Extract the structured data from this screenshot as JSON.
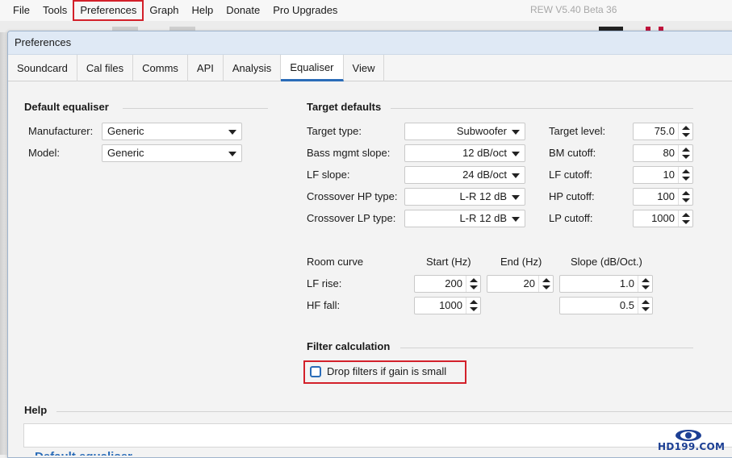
{
  "app": {
    "menu": [
      "File",
      "Tools",
      "Preferences",
      "Graph",
      "Help",
      "Donate",
      "Pro Upgrades"
    ],
    "highlighted_menu": "Preferences",
    "title": "REW V5.40 Beta 36"
  },
  "dialog": {
    "title": "Preferences",
    "tabs": [
      "Soundcard",
      "Cal files",
      "Comms",
      "API",
      "Analysis",
      "Equaliser",
      "View"
    ],
    "active_tab": "Equaliser"
  },
  "default_equaliser": {
    "title": "Default equaliser",
    "manufacturer_label": "Manufacturer:",
    "manufacturer_value": "Generic",
    "model_label": "Model:",
    "model_value": "Generic"
  },
  "target_defaults": {
    "title": "Target defaults",
    "target_type_label": "Target type:",
    "target_type_value": "Subwoofer",
    "bass_mgmt_label": "Bass mgmt slope:",
    "bass_mgmt_value": "12 dB/oct",
    "lf_slope_label": "LF slope:",
    "lf_slope_value": "24 dB/oct",
    "crossover_hp_label": "Crossover HP type:",
    "crossover_hp_value": "L-R 12 dB",
    "crossover_lp_label": "Crossover LP type:",
    "crossover_lp_value": "L-R 12 dB",
    "target_level_label": "Target level:",
    "target_level_value": "75.0",
    "bm_cutoff_label": "BM cutoff:",
    "bm_cutoff_value": "80",
    "lf_cutoff_label": "LF cutoff:",
    "lf_cutoff_value": "10",
    "hp_cutoff_label": "HP cutoff:",
    "hp_cutoff_value": "100",
    "lp_cutoff_label": "LP cutoff:",
    "lp_cutoff_value": "1000"
  },
  "room_curve": {
    "title": "Room curve",
    "start_header": "Start (Hz)",
    "end_header": "End (Hz)",
    "slope_header": "Slope (dB/Oct.)",
    "lf_rise_label": "LF rise:",
    "lf_rise_start": "200",
    "lf_rise_end": "20",
    "lf_rise_slope": "1.0",
    "hf_fall_label": "HF fall:",
    "hf_fall_start": "1000",
    "hf_fall_slope": "0.5"
  },
  "filter_calculation": {
    "title": "Filter calculation",
    "drop_filters_label": "Drop filters if gain is small",
    "drop_filters_checked": false
  },
  "help": {
    "title": "Help",
    "heading": "Default equaliser"
  },
  "watermark": {
    "text": "HD199.COM"
  },
  "colors": {
    "accent": "#2a6cb8",
    "highlight_border": "#d3202a",
    "titlebar": "#dfe9f5"
  }
}
